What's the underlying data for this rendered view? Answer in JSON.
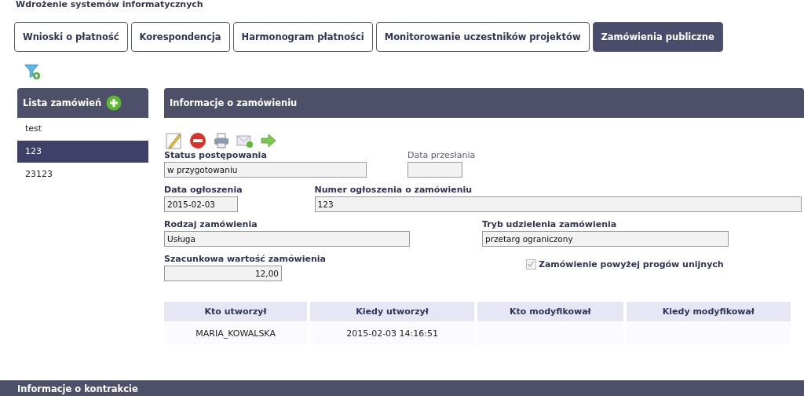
{
  "page_title": "Wdrożenie systemów informatycznych",
  "tabs": [
    {
      "label": "Wnioski o płatność",
      "selected": false
    },
    {
      "label": "Korespondencja",
      "selected": false
    },
    {
      "label": "Harmonogram płatności",
      "selected": false
    },
    {
      "label": "Monitorowanie uczestników projektów",
      "selected": false
    },
    {
      "label": "Zamówienia publiczne",
      "selected": true
    }
  ],
  "order_list": {
    "title": "Lista zamówień",
    "items": [
      {
        "label": "test",
        "selected": false
      },
      {
        "label": "123",
        "selected": true
      },
      {
        "label": "23123",
        "selected": false
      }
    ]
  },
  "order_info": {
    "title": "Informacje o zamówieniu",
    "fields": [
      {
        "label": "Status postępowania",
        "value": "w przygotowaniu",
        "kind": "status"
      },
      {
        "label": "Data przesłania",
        "kind": "sent"
      },
      {
        "label": "Data ogłoszenia",
        "value": "2015-02-03",
        "kind": "date"
      },
      {
        "label": "Numer ogłoszenia o zamówieniu",
        "value": "123",
        "kind": "number"
      },
      {
        "label": "Rodzaj zamówienia",
        "value": "Usługa",
        "kind": "type"
      },
      {
        "label": "Tryb udzielenia zamówienia",
        "value": "przetarg ograniczony",
        "kind": "mode"
      },
      {
        "label": "Szacunkowa wartość zamówienia",
        "value": "12,00",
        "kind": "amount"
      }
    ],
    "eu_threshold": {
      "label": "Zamówienie powyżej progów unijnych",
      "checked": true,
      "disabled": true
    },
    "audit_table": {
      "columns": [
        "Kto utworzył",
        "Kiedy utworzył",
        "Kto modyfikował",
        "Kiedy modyfikował"
      ],
      "rows": [
        [
          "MARIA_KOWALSKA",
          "2015-02-03 14:16:51",
          "",
          ""
        ]
      ]
    }
  },
  "contract_section": {
    "title": "Informacje o kontrakcie"
  }
}
